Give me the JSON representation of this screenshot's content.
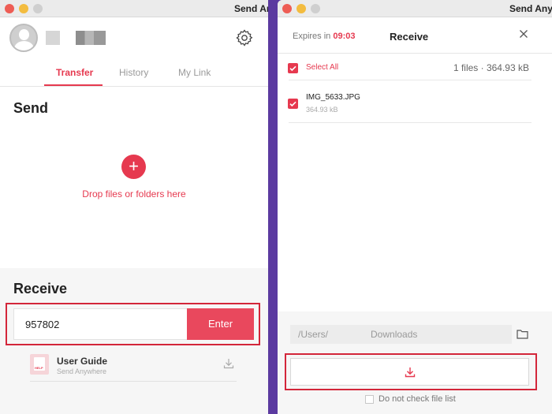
{
  "left_window": {
    "title": "Send Anyw",
    "tabs": [
      {
        "label": "Transfer",
        "active": true
      },
      {
        "label": "History",
        "active": false
      },
      {
        "label": "My Link",
        "active": false
      }
    ],
    "send_title": "Send",
    "drop_text": "Drop files or folders here",
    "plus_label": "+",
    "receive_title": "Receive",
    "key_input_value": "957802",
    "enter_label": "Enter",
    "guide": {
      "icon_text": "HELP",
      "title": "User Guide",
      "subtitle": "Send Anywhere"
    }
  },
  "right_window": {
    "title": "Send Anyw",
    "expires_label": "Expires in",
    "expires_time": "09:03",
    "header_title": "Receive",
    "select_all_label": "Select All",
    "file_summary": "1 files · 364.93 kB",
    "files": [
      {
        "name": "IMG_5633.JPG",
        "size": "364.93 kB",
        "checked": true
      }
    ],
    "path_start": "/Users/",
    "path_end": "Downloads",
    "no_check_label": "Do not check file list"
  },
  "colors": {
    "accent": "#e6394f",
    "highlight_border": "#d3263a",
    "background": "#5b3aa0"
  },
  "icons": [
    "settings-gear-icon",
    "plus-icon",
    "download-icon",
    "close-icon",
    "folder-icon",
    "checkmark-icon",
    "avatar-icon"
  ]
}
